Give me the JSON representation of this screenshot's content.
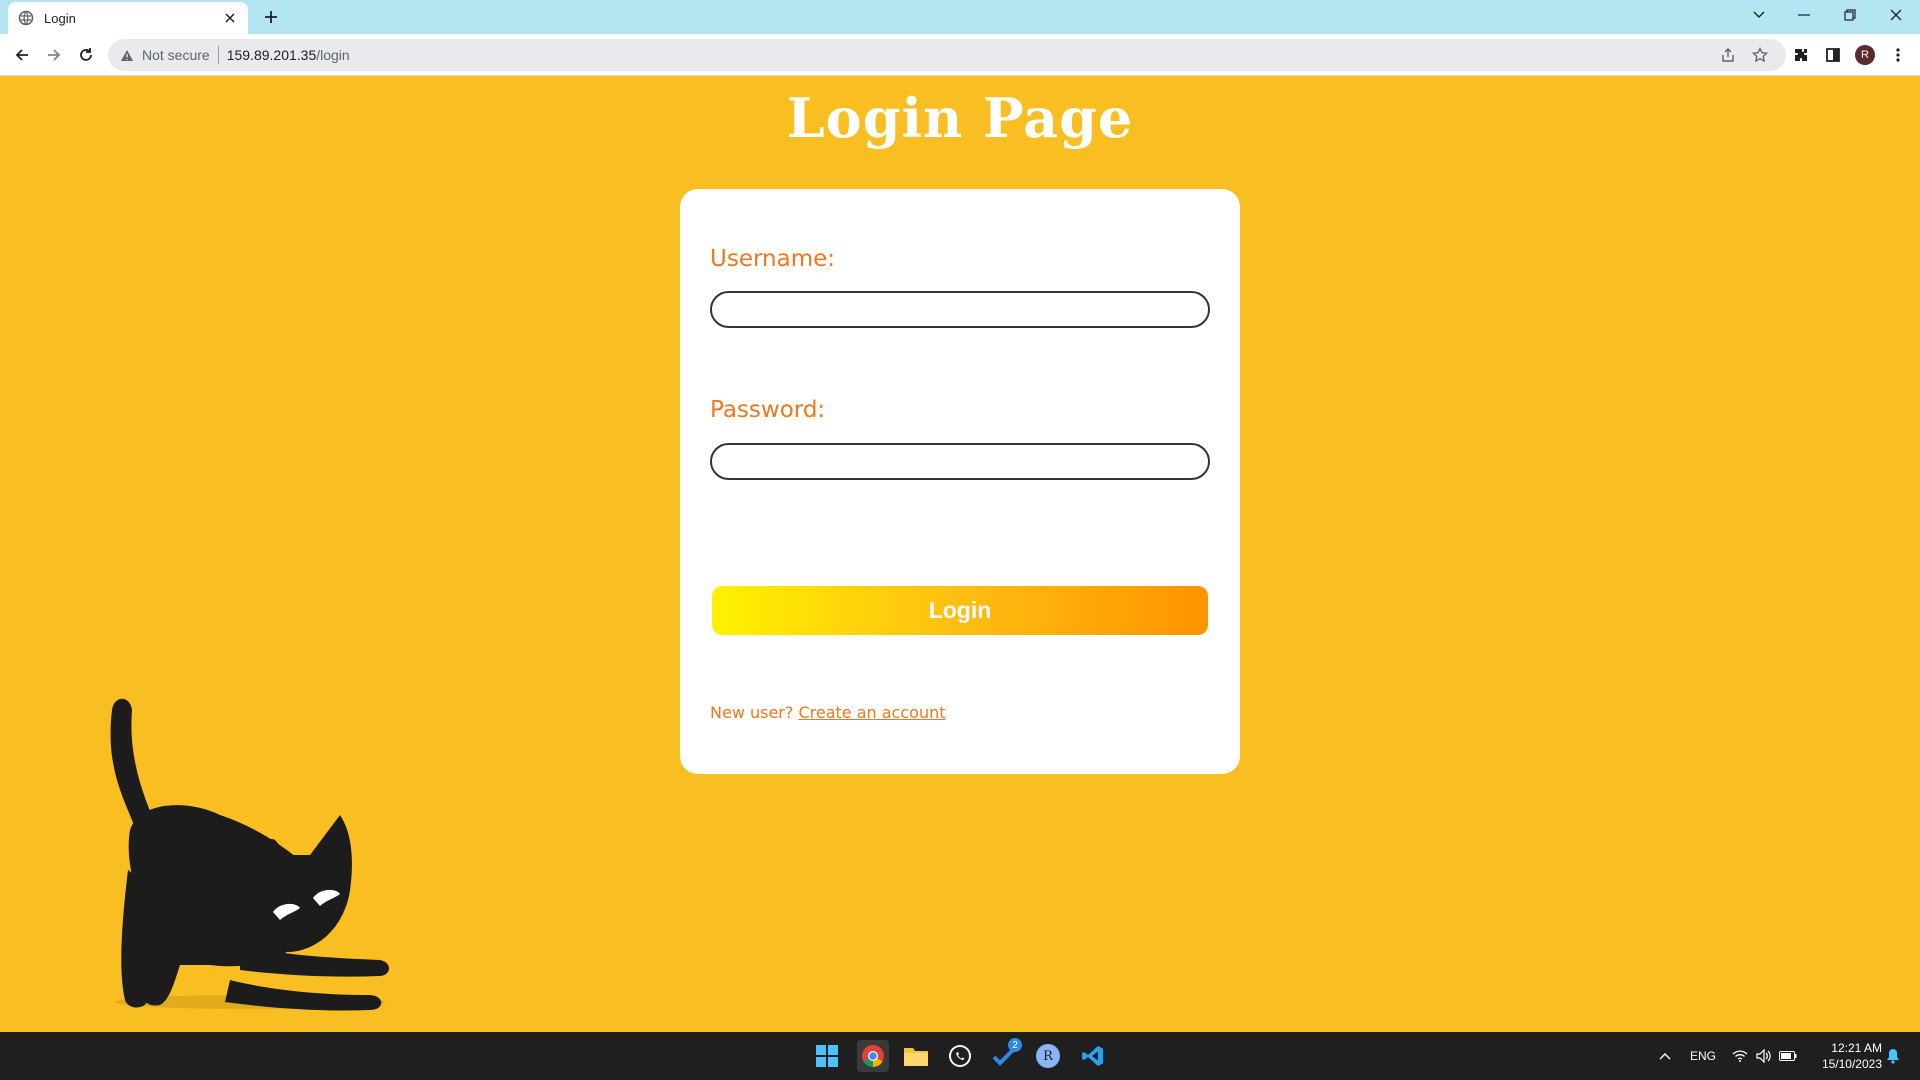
{
  "browser": {
    "tab_title": "Login",
    "security_label": "Not secure",
    "url_host": "159.89.201.35",
    "url_path": "/login",
    "profile_initial": "R"
  },
  "page": {
    "title": "Login Page",
    "username_label": "Username:",
    "username_value": "",
    "password_label": "Password:",
    "password_value": "",
    "login_button": "Login",
    "new_user_text": "New user?",
    "create_account_link": "Create an account"
  },
  "taskbar": {
    "language": "ENG",
    "time": "12:21 AM",
    "date": "15/10/2023",
    "steam_badge": "2",
    "app_letter": "R"
  },
  "colors": {
    "background": "#f9be22",
    "accent_text": "#f2761c",
    "tab_strip": "#b3e5f2"
  }
}
